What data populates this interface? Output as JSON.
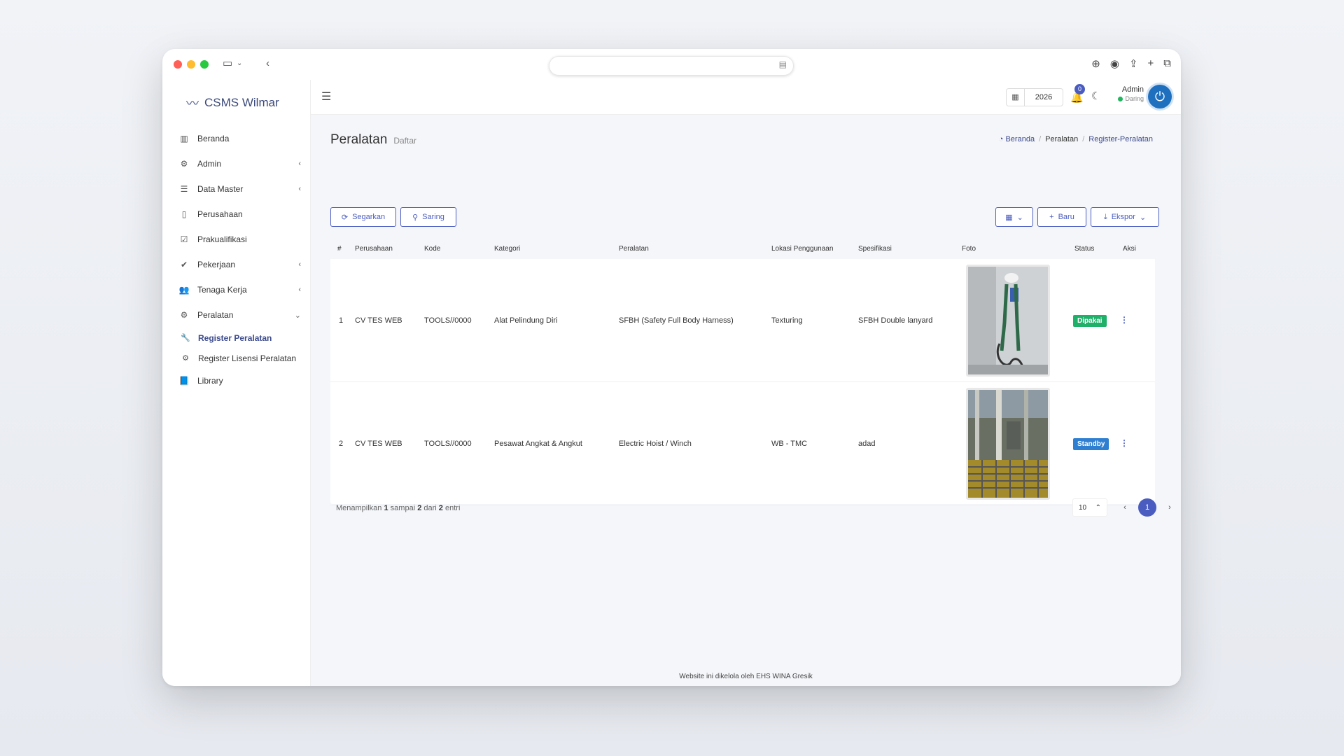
{
  "app": {
    "brand": "CSMS Wilmar"
  },
  "sidebar": {
    "items": [
      {
        "label": "Beranda",
        "icon": "bar-chart-icon"
      },
      {
        "label": "Admin",
        "icon": "gear-icon"
      },
      {
        "label": "Data Master",
        "icon": "database-icon"
      },
      {
        "label": "Perusahaan",
        "icon": "building-icon"
      },
      {
        "label": "Prakualifikasi",
        "icon": "calendar-check-icon"
      },
      {
        "label": "Pekerjaan",
        "icon": "check-square-icon"
      },
      {
        "label": "Tenaga Kerja",
        "icon": "users-icon"
      },
      {
        "label": "Peralatan",
        "icon": "gears-icon"
      },
      {
        "label": "Library",
        "icon": "book-icon"
      }
    ],
    "subitems": [
      {
        "label": "Register Peralatan",
        "icon": "wrench-icon"
      },
      {
        "label": "Register Lisensi Peralatan",
        "icon": "gears-icon"
      }
    ]
  },
  "topbar": {
    "year": "2026",
    "notifications": "0",
    "user_name": "Admin",
    "user_status": "Daring"
  },
  "page": {
    "title": "Peralatan",
    "subtitle": "Daftar",
    "breadcrumb": [
      "Beranda",
      "Peralatan",
      "Register-Peralatan"
    ]
  },
  "toolbar": {
    "refresh": "Segarkan",
    "filter": "Saring",
    "new": "Baru",
    "export": "Ekspor"
  },
  "table": {
    "headers": [
      "#",
      "Perusahaan",
      "Kode",
      "Kategori",
      "Peralatan",
      "Lokasi Penggunaan",
      "Spesifikasi",
      "Foto",
      "Status",
      "Aksi"
    ],
    "rows": [
      {
        "no": "1",
        "company": "CV TES WEB",
        "code": "TOOLS//0000",
        "category": "Alat Pelindung Diri",
        "equipment": "SFBH (Safety Full Body Harness)",
        "location": "Texturing",
        "spec": "SFBH Double lanyard",
        "status": "Dipakai",
        "status_color": "#1fb16a"
      },
      {
        "no": "2",
        "company": "CV TES WEB",
        "code": "TOOLS//0000",
        "category": "Pesawat Angkat & Angkut",
        "equipment": "Electric Hoist / Winch",
        "location": "WB - TMC",
        "spec": "adad",
        "status": "Standby",
        "status_color": "#2e7fd1"
      }
    ]
  },
  "pagination": {
    "info_prefix": "Menampilkan",
    "from": "1",
    "mid": "sampai",
    "to": "2",
    "of_label": "dari",
    "total": "2",
    "suffix": "entri",
    "per_page": "10",
    "current_page": "1"
  },
  "footer": {
    "text": "Website ini dikelola oleh EHS WINA Gresik"
  }
}
